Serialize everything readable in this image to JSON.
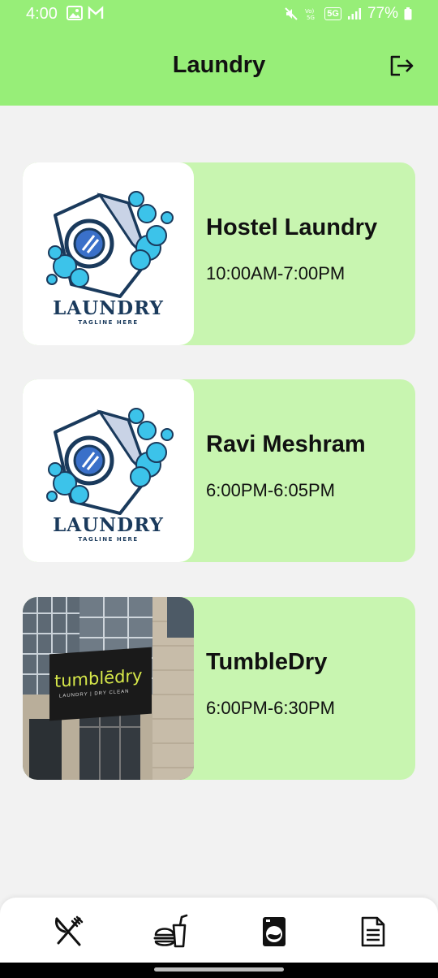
{
  "status_bar": {
    "time": "4:00",
    "battery": "77%",
    "network": "5G"
  },
  "header": {
    "title": "Laundry"
  },
  "laundries": [
    {
      "name": "Hostel Laundry",
      "hours": "10:00AM-7:00PM",
      "image": "laundry-logo",
      "logo_word": "LAUNDRY",
      "logo_tagline": "TAGLINE HERE"
    },
    {
      "name": "Ravi Meshram",
      "hours": "6:00PM-6:05PM",
      "image": "laundry-logo",
      "logo_word": "LAUNDRY",
      "logo_tagline": "TAGLINE HERE"
    },
    {
      "name": "TumbleDry",
      "hours": "6:00PM-6:30PM",
      "image": "storefront-photo",
      "sign_name": "tumblēdry",
      "sign_subtitle": "LAUNDRY | DRY CLEAN"
    }
  ],
  "bottom_nav": [
    {
      "icon": "fork-knife-icon"
    },
    {
      "icon": "burger-drink-icon"
    },
    {
      "icon": "washing-machine-icon"
    },
    {
      "icon": "document-icon"
    }
  ],
  "colors": {
    "header_bg": "#97ee78",
    "card_bg": "#c8f5b0",
    "page_bg": "#f2f2f2",
    "logo_blue": "#1a3a5c",
    "bubble": "#3cc3ea"
  }
}
